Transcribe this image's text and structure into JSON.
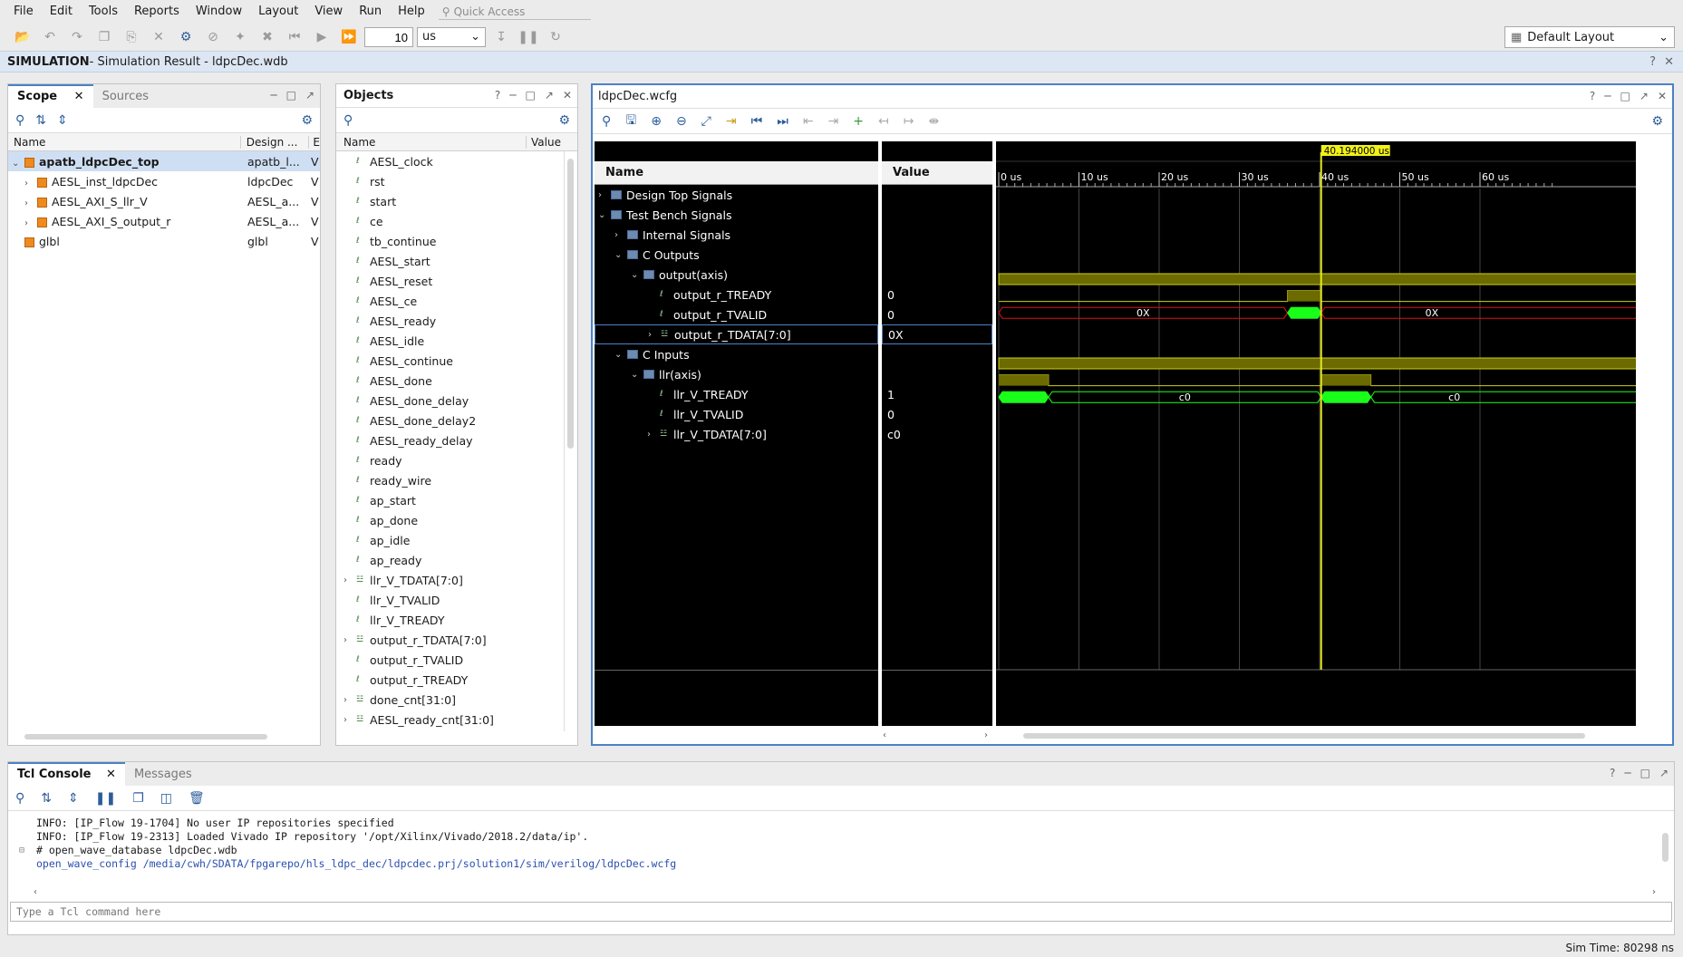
{
  "menu": [
    "File",
    "Edit",
    "Tools",
    "Reports",
    "Window",
    "Layout",
    "View",
    "Run",
    "Help"
  ],
  "quick_access": "Quick Access",
  "run_time": {
    "value": "10",
    "unit": "us"
  },
  "layout": {
    "label": "Default Layout"
  },
  "simbar": {
    "mode": "SIMULATION",
    "title": " - Simulation Result - ldpcDec.wdb"
  },
  "scope": {
    "tabs": [
      "Scope",
      "Sources"
    ],
    "columns": [
      "Name",
      "Design ...",
      "E"
    ],
    "rows": [
      {
        "name": "apatb_ldpcDec_top",
        "design": "apatb_l...",
        "e": "V"
      },
      {
        "name": "AESL_inst_ldpcDec",
        "design": "ldpcDec",
        "e": "V"
      },
      {
        "name": "AESL_AXI_S_llr_V",
        "design": "AESL_a...",
        "e": "V"
      },
      {
        "name": "AESL_AXI_S_output_r",
        "design": "AESL_a...",
        "e": "V"
      },
      {
        "name": "glbl",
        "design": "glbl",
        "e": "V"
      }
    ]
  },
  "objects": {
    "title": "Objects",
    "columns": [
      "Name",
      "Value"
    ],
    "rows": [
      "AESL_clock",
      "rst",
      "start",
      "ce",
      "tb_continue",
      "AESL_start",
      "AESL_reset",
      "AESL_ce",
      "AESL_ready",
      "AESL_idle",
      "AESL_continue",
      "AESL_done",
      "AESL_done_delay",
      "AESL_done_delay2",
      "AESL_ready_delay",
      "ready",
      "ready_wire",
      "ap_start",
      "ap_done",
      "ap_idle",
      "ap_ready",
      "llr_V_TDATA[7:0]",
      "llr_V_TVALID",
      "llr_V_TREADY",
      "output_r_TDATA[7:0]",
      "output_r_TVALID",
      "output_r_TREADY",
      "done_cnt[31:0]",
      "AESL_ready_cnt[31:0]"
    ]
  },
  "wave": {
    "title": "ldpcDec.wcfg",
    "name_header": "Name",
    "value_header": "Value",
    "cursor_label": "40.194000 us",
    "ticks": [
      "0 us",
      "10 us",
      "20 us",
      "30 us",
      "40 us",
      "50 us",
      "60 us"
    ],
    "signals": [
      {
        "name": "Design Top Signals",
        "value": ""
      },
      {
        "name": "Test Bench Signals",
        "value": ""
      },
      {
        "name": "Internal Signals",
        "value": ""
      },
      {
        "name": "C Outputs",
        "value": ""
      },
      {
        "name": "output(axis)",
        "value": ""
      },
      {
        "name": "output_r_TREADY",
        "value": "0"
      },
      {
        "name": "output_r_TVALID",
        "value": "0"
      },
      {
        "name": "output_r_TDATA[7:0]",
        "value": "0X"
      },
      {
        "name": "C Inputs",
        "value": ""
      },
      {
        "name": "llr(axis)",
        "value": ""
      },
      {
        "name": "llr_V_TREADY",
        "value": "1"
      },
      {
        "name": "llr_V_TVALID",
        "value": "0"
      },
      {
        "name": "llr_V_TDATA[7:0]",
        "value": "c0"
      }
    ],
    "bus_labels": {
      "out_a": "0X",
      "out_b": "0X",
      "in_a": "c0",
      "in_b": "c0"
    }
  },
  "console": {
    "tabs": [
      "Tcl Console",
      "Messages"
    ],
    "lines": [
      "INFO: [IP_Flow 19-1704] No user IP repositories specified",
      "INFO: [IP_Flow 19-2313] Loaded Vivado IP repository '/opt/Xilinx/Vivado/2018.2/data/ip'.",
      "# open_wave_database ldpcDec.wdb",
      "open_wave_config /media/cwh/SDATA/fpgarepo/hls_ldpc_dec/ldpcdec.prj/solution1/sim/verilog/ldpcDec.wcfg"
    ],
    "placeholder": "Type a Tcl command here"
  },
  "status": "Sim Time: 80298 ns"
}
